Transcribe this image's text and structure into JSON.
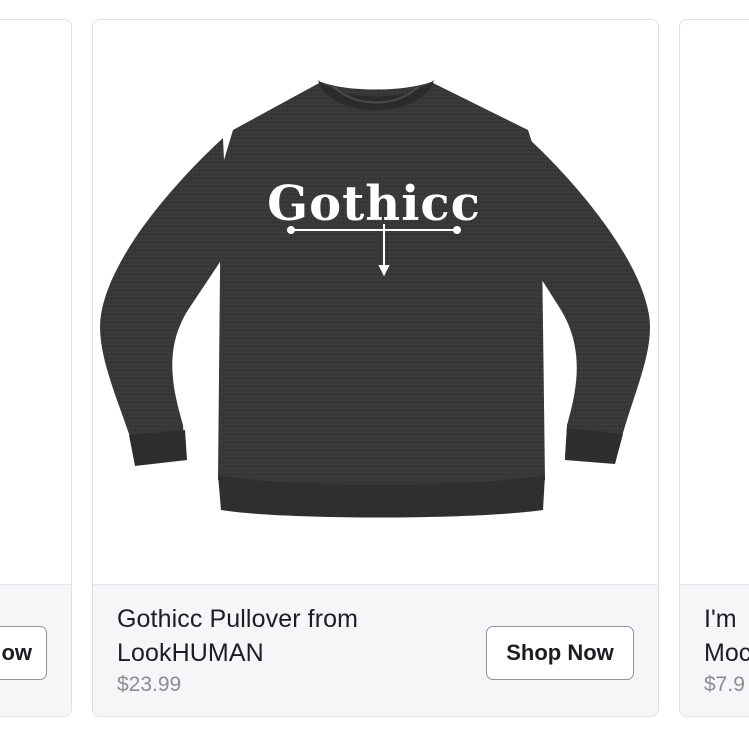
{
  "carousel": {
    "prev_card": {
      "button_label": "Shop Now"
    },
    "main_card": {
      "image_alt": "Black crewneck sweatshirt with Gothicc print",
      "print_text": "Gothicc",
      "title": "Gothicc Pullover from LookHUMAN",
      "price": "$23.99",
      "button_label": "Shop Now"
    },
    "next_card": {
      "title_line1": "I'm",
      "title_line2": "Moc",
      "price": "$7.9"
    }
  },
  "colors": {
    "footer_bg": "#f5f6f7",
    "card_border": "#dddfe2",
    "text_primary": "#1c1e21",
    "text_secondary": "#8a8d91",
    "button_border": "#8d949e",
    "sweater": "#3a3a3c"
  }
}
